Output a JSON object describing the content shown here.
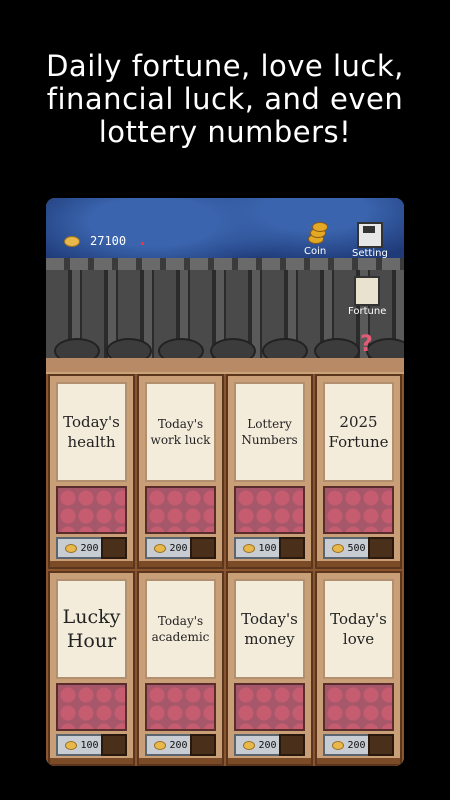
{
  "headline": {
    "line1": "Daily fortune, love luck,",
    "line2": "financial luck, and even",
    "line3": "lottery numbers!"
  },
  "header": {
    "coins": "27100",
    "buttons": {
      "coin": "Coin",
      "setting": "Setting",
      "fortune": "Fortune"
    }
  },
  "cards": [
    {
      "title": "Today's health",
      "price": "200",
      "style": "f15"
    },
    {
      "title": "Today's work luck",
      "price": "200",
      "style": "f13"
    },
    {
      "title": "Lottery Numbers",
      "price": "100",
      "style": "f13"
    },
    {
      "title": "2025 Fortune",
      "price": "500",
      "style": "f15"
    },
    {
      "title": "Lucky Hour",
      "price": "100",
      "style": "f18"
    },
    {
      "title": "Today's academic",
      "price": "200",
      "style": "f13"
    },
    {
      "title": "Today's money",
      "price": "200",
      "style": "f15"
    },
    {
      "title": "Today's love",
      "price": "200",
      "style": "f15"
    }
  ],
  "colors": {
    "coinGold": "#e8b84a",
    "sky": "#1f3a78",
    "woodFrame": "#8a5632"
  }
}
